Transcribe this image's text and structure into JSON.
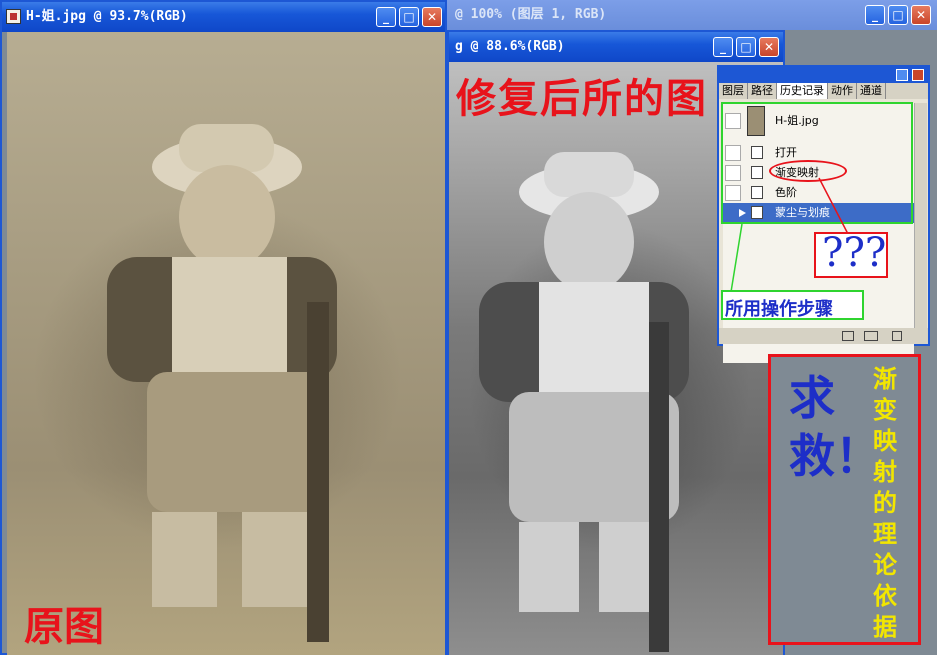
{
  "windows": {
    "left_title": "H-姐.jpg @ 93.7%(RGB)",
    "back_title": "@ 100% (图层 1, RGB)",
    "middle_title": "g @ 88.6%(RGB)"
  },
  "annotations": {
    "original": "原图",
    "restored": "修复后所的图",
    "help": "求救！",
    "question": "渐变映射的理论依据",
    "qmarks": "???",
    "steps": "所用操作步骤"
  },
  "history_panel": {
    "tabs": [
      "图层",
      "路径",
      "历史记录",
      "动作",
      "通道"
    ],
    "active_tab": "历史记录",
    "snapshot": "H-姐.jpg",
    "steps": [
      "打开",
      "渐变映射",
      "色阶",
      "蒙尘与划痕"
    ]
  },
  "colors": {
    "red": "#e8131b",
    "blue": "#1d2ec8",
    "yellow": "#f2e600",
    "green": "#2fd42f"
  }
}
